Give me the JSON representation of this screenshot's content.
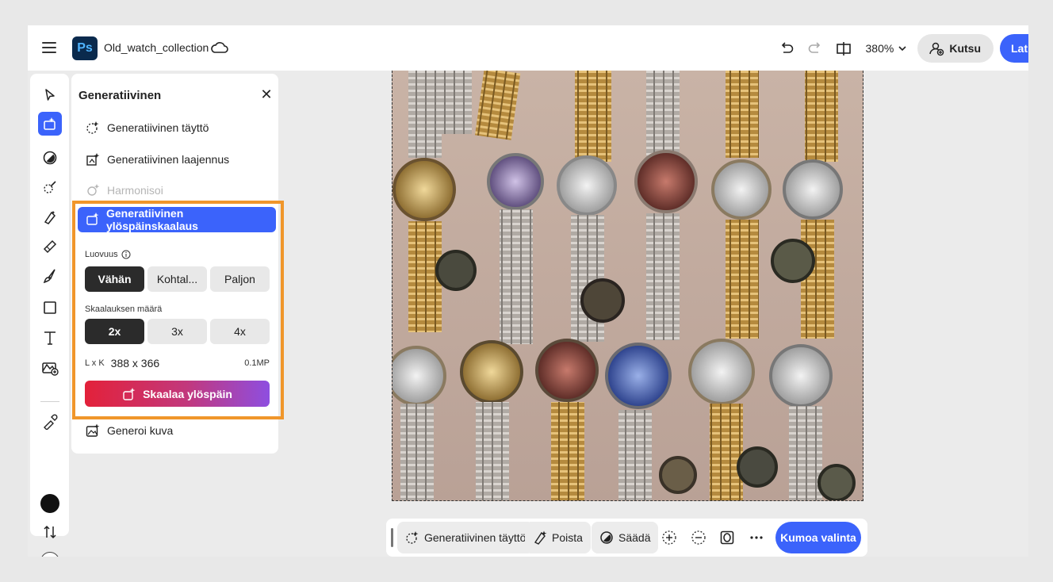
{
  "header": {
    "app_logo": "Ps",
    "doc_title": "Old_watch_collection",
    "zoom": "380%",
    "invite_label": "Kutsu",
    "primary_partial_label": "Lat"
  },
  "panel": {
    "title": "Generatiivinen",
    "items": [
      {
        "label": "Generatiivinen täyttö",
        "icon": "generative-fill-icon"
      },
      {
        "label": "Generatiivinen laajennus",
        "icon": "generative-expand-icon"
      },
      {
        "label": "Harmonisoi",
        "icon": "harmonize-icon",
        "disabled": true
      },
      {
        "label": "Generatiivinen ylöspäinskaalaus",
        "icon": "generative-upscale-icon",
        "active": true
      }
    ],
    "creativity_label": "Luovuus",
    "creativity_options": [
      "Vähän",
      "Kohtal...",
      "Paljon"
    ],
    "creativity_selected": "Vähän",
    "scale_label": "Skaalauksen määrä",
    "scale_options": [
      "2x",
      "3x",
      "4x"
    ],
    "scale_selected": "2x",
    "dims_prefix": "L x K",
    "dims_value": "388 x 366",
    "megapixels": "0.1MP",
    "upscale_button": "Skaalaa ylöspäin",
    "generate_image": "Generoi kuva"
  },
  "taskbar": {
    "gen_fill": "Generatiivinen täyttö",
    "remove": "Poista",
    "adjust": "Säädä",
    "deselect": "Kumoa valinta"
  },
  "colors": {
    "accent": "#3b63fb",
    "highlight": "#f0962b",
    "foreground": "#111111",
    "background": "#ffffff"
  }
}
